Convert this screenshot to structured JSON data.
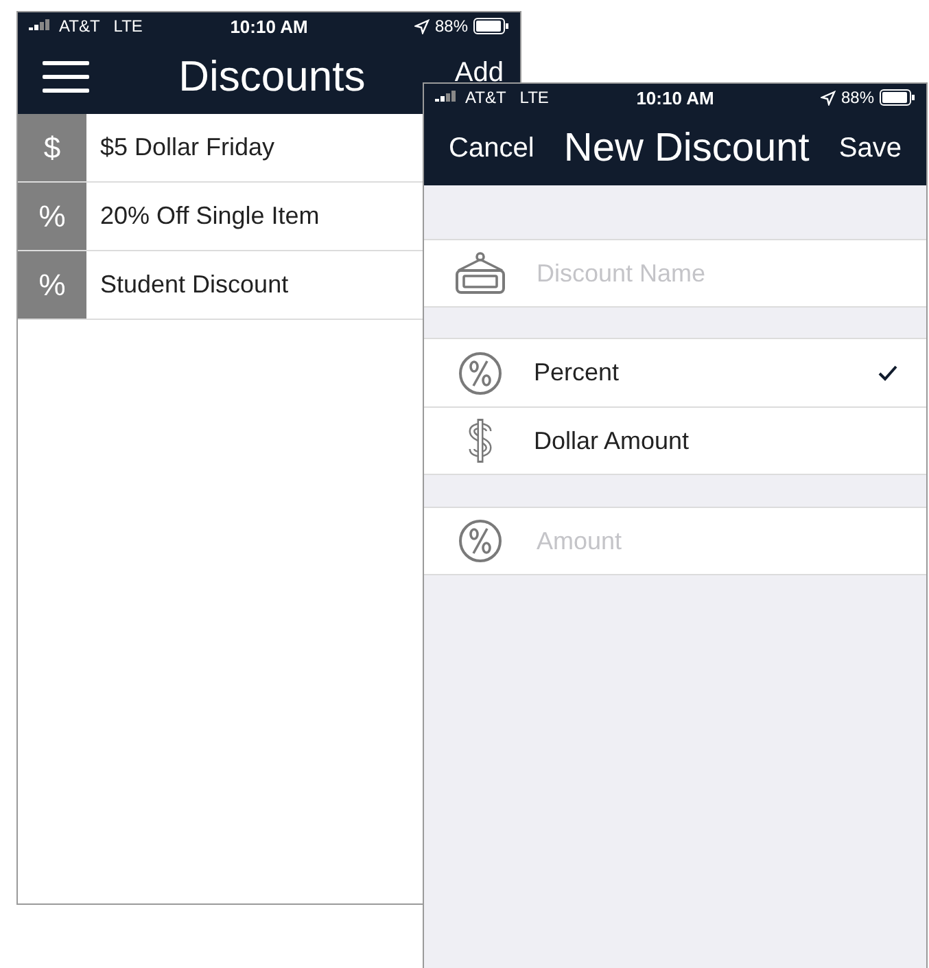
{
  "list_screen": {
    "status_bar": {
      "carrier": "AT&T",
      "network": "LTE",
      "time": "10:10 AM",
      "battery": "88%"
    },
    "title": "Discounts",
    "add_button": "Add",
    "discounts": [
      {
        "symbol": "$",
        "name": "$5 Dollar Friday"
      },
      {
        "symbol": "%",
        "name": "20% Off Single Item"
      },
      {
        "symbol": "%",
        "name": "Student Discount"
      }
    ]
  },
  "new_discount_screen": {
    "status_bar": {
      "carrier": "AT&T",
      "network": "LTE",
      "time": "10:10 AM",
      "battery": "88%"
    },
    "cancel_button": "Cancel",
    "title": "New Discount",
    "save_button": "Save",
    "name_field": {
      "placeholder": "Discount Name"
    },
    "types": [
      {
        "kind": "percent",
        "label": "Percent",
        "selected": true
      },
      {
        "kind": "dollar",
        "label": "Dollar Amount",
        "selected": false
      }
    ],
    "amount_field": {
      "placeholder": "Amount"
    }
  }
}
